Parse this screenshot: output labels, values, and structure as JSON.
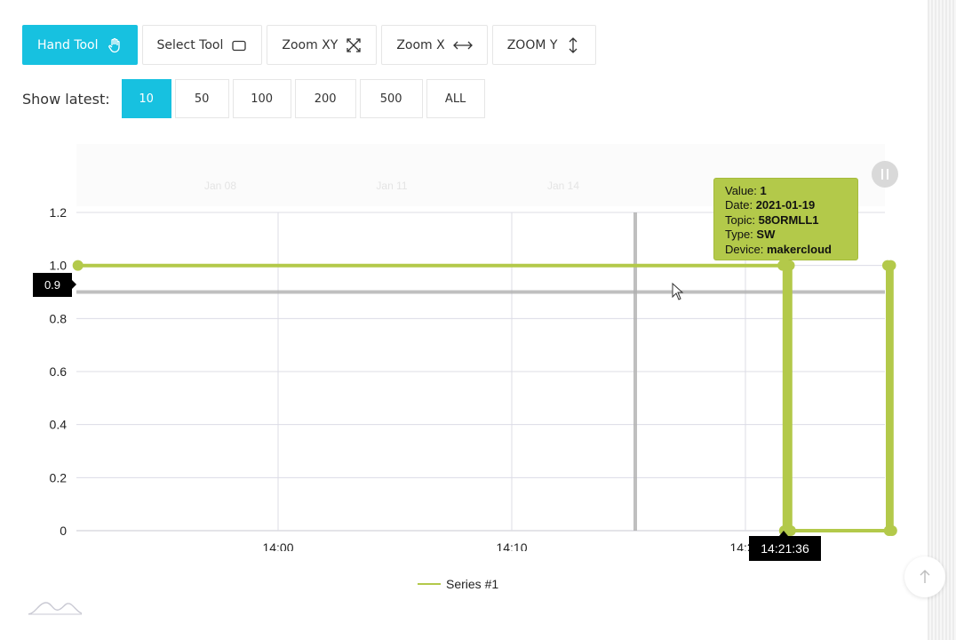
{
  "toolbar": {
    "tools": [
      {
        "label": "Hand Tool",
        "icon": "hand-icon",
        "active": true
      },
      {
        "label": "Select Tool",
        "icon": "rectangle-select-icon",
        "active": false
      },
      {
        "label": "Zoom XY",
        "icon": "expand-diagonal-icon",
        "active": false
      },
      {
        "label": "Zoom X",
        "icon": "horizontal-arrows-icon",
        "active": false
      },
      {
        "label": "ZOOM Y",
        "icon": "vertical-arrows-icon",
        "active": false
      }
    ]
  },
  "show_latest": {
    "label": "Show latest:",
    "options": [
      "10",
      "50",
      "100",
      "200",
      "500",
      "ALL"
    ],
    "selected": "10"
  },
  "colors": {
    "accent": "#17c1e0",
    "series": "#b3c94a",
    "crosshair": "#b0b0b0"
  },
  "tooltip": {
    "value_label": "Value:",
    "value": "1",
    "date_label": "Date:",
    "date": "2021-01-19",
    "topic_label": "Topic:",
    "topic": "58ORMLL1",
    "type_label": "Type:",
    "type": "SW",
    "device_label": "Device:",
    "device": "makercloud"
  },
  "crosshair": {
    "y_value": "0.9",
    "x_value": "14:21:36"
  },
  "chart_data": {
    "type": "line",
    "title": "",
    "xlabel": "",
    "ylabel": "",
    "ylim": [
      0,
      1.2
    ],
    "yticks": [
      "0",
      "0.2",
      "0.4",
      "0.6",
      "0.8",
      "1.0",
      "1.2"
    ],
    "xticks": [
      "14:00",
      "14:10",
      "14:20"
    ],
    "navigator_ticks": [
      "Jan 08",
      "Jan 11",
      "Jan 14"
    ],
    "grid": true,
    "legend": "bottom-center",
    "series": [
      {
        "name": "Series #1",
        "x": [
          "13:51:26",
          "14:21:36",
          "14:21:40",
          "14:21:47",
          "14:21:50",
          "14:21:53",
          "14:21:56",
          "14:26:05",
          "14:26:09",
          "14:26:13",
          "14:26:16"
        ],
        "values": [
          1,
          1,
          0,
          1,
          0,
          1,
          0,
          1,
          0,
          1,
          0
        ]
      }
    ]
  },
  "scroll_top_icon": "arrow-up-icon",
  "menu_icon": "pause-menu-icon"
}
